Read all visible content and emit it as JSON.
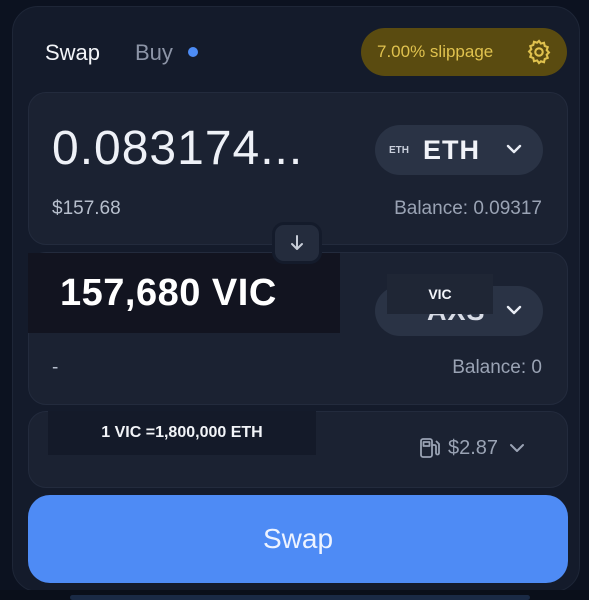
{
  "header": {
    "tabs": [
      {
        "label": "Swap"
      },
      {
        "label": "Buy"
      }
    ],
    "slippage_label": "7.00% slippage"
  },
  "sell": {
    "amount": "0.083174...",
    "usd_value": "$157.68",
    "token_small": "ETH",
    "token": "ETH",
    "balance": "Balance: 0.09317"
  },
  "buy": {
    "overlay_amount": "157,680 VIC",
    "overlay_token": "VIC",
    "token_ghost": "AXS",
    "amount": "-",
    "balance": "Balance: 0"
  },
  "rate": {
    "overlay_text": "1 VIC =1,800,000 ETH",
    "gas_fee": "$2.87"
  },
  "swap_button": "Swap",
  "colors": {
    "accent": "#4e8bf5",
    "slippage_bg": "#5a4b10",
    "slippage_text": "#e0c24e"
  }
}
